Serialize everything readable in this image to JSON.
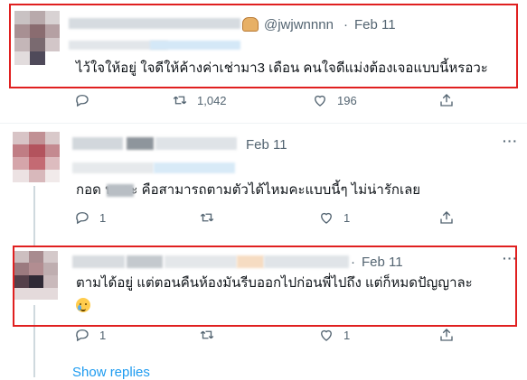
{
  "tweets": [
    {
      "handle": "@jwjwnnnn",
      "separator": "·",
      "date": "Feb 11",
      "text": "ไว้ใจให้อยู่ ใจดีให้ค้างค่าเช่ามา3 เดือน คนใจดีแม่งต้องเจอแบบนี้หรอวะ",
      "retweets": "1,042",
      "likes": "196",
      "highlighted": true
    },
    {
      "date": "Feb 11",
      "text": "กอด           นะคะ คือสามารถตามตัวได้ไหมคะแบบนี้ๆ ไม่น่ารักเลย",
      "replies": "1",
      "likes": "1",
      "highlighted": false
    },
    {
      "separator": "·",
      "date": "Feb 11",
      "text": "ตามได้อยู่ แต่ตอนคืนห้องมันรีบออกไปก่อนพี่ไปถึง  แต่ก็หมดปัญญาละ",
      "replies": "1",
      "likes": "1",
      "highlighted": true
    }
  ],
  "show_replies": "Show replies",
  "icons": [
    "reply-icon",
    "retweet-icon",
    "like-icon",
    "share-icon",
    "more-icon",
    "bread-emoji-icon",
    "crying-laughing-emoji-icon"
  ],
  "colors": {
    "highlight": "#e02020",
    "link": "#1d9bf0",
    "muted": "#536471"
  }
}
